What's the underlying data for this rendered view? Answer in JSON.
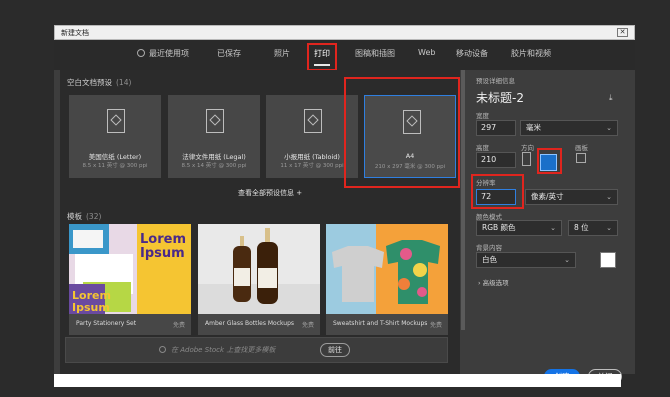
{
  "window": {
    "title": "新建文档",
    "close": "✕"
  },
  "tabs": [
    {
      "label": "最近使用项"
    },
    {
      "label": "已保存"
    },
    {
      "label": "照片"
    },
    {
      "label": "打印"
    },
    {
      "label": "图稿和插图"
    },
    {
      "label": "Web"
    },
    {
      "label": "移动设备"
    },
    {
      "label": "胶片和视频"
    }
  ],
  "blank_presets": {
    "heading": "空白文档预设",
    "count": "(14)",
    "items": [
      {
        "name": "美国信纸 (Letter)",
        "dims": "8.5 x 11 英寸 @ 300 ppi"
      },
      {
        "name": "法律文件用纸 (Legal)",
        "dims": "8.5 x 14 英寸 @ 300 ppi"
      },
      {
        "name": "小报用纸 (Tabloid)",
        "dims": "11 x 17 英寸 @ 300 ppi"
      },
      {
        "name": "A4",
        "dims": "210 x 297 毫米 @ 300 ppi"
      }
    ],
    "view_all": "查看全部预设信息 +"
  },
  "templates": {
    "heading": "模板",
    "count": "(32)",
    "items": [
      {
        "name": "Party Stationery Set",
        "tag": "免费",
        "art_title": "Lorem Ipsum"
      },
      {
        "name": "Amber Glass Bottles Mockups",
        "tag": "免费"
      },
      {
        "name": "Sweatshirt and T-Shirt Mockups",
        "tag": "免费"
      }
    ]
  },
  "stock": {
    "placeholder": "在 Adobe Stock 上查找更多模板",
    "go_label": "前往"
  },
  "details": {
    "heading": "预设详细信息",
    "doc_name": "未标题-2",
    "width_label": "宽度",
    "width_value": "297",
    "width_unit": "毫米",
    "height_label": "高度",
    "height_value": "210",
    "orientation_label": "方向",
    "artboard_label": "画板",
    "resolution_label": "分辨率",
    "resolution_value": "72",
    "resolution_unit": "像素/英寸",
    "color_mode_label": "颜色模式",
    "color_mode_value": "RGB 颜色",
    "bit_depth": "8 位",
    "bg_label": "背景内容",
    "bg_value": "白色",
    "advanced": "› 高级选项"
  },
  "actions": {
    "create": "创建",
    "close": "关闭"
  },
  "colors": {
    "accent": "#1473e6",
    "highlight": "#e0251e",
    "selected_border": "#2f7fe0"
  }
}
